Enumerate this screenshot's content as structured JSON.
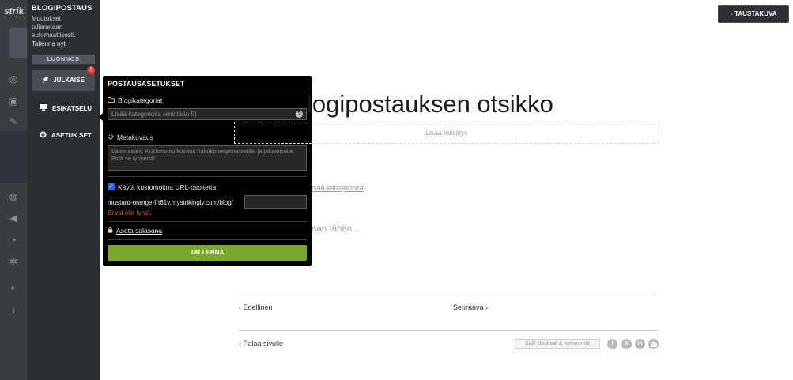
{
  "rail": {
    "logo": "strik"
  },
  "sidebar": {
    "title": "BLOGIPOSTAUS",
    "note": "Muutokset tallenetaan automaattisesti.",
    "save_now": "Tallenna nyt",
    "draft": "LUONNOS",
    "publish": "JULKAISE",
    "alert": "!",
    "preview": "ESIKATSELU",
    "settings": "ASETUK SET"
  },
  "popover": {
    "title": "POSTAUSASETUKSET",
    "category_label": "Blogikategoriat",
    "category_placeholder": "Lisää kategorioita (enintään 5)",
    "meta_label": "Metakuvaus",
    "meta_placeholder": "Valinnainen. Kustomoitu kuvaus hakukoneoptimoinnille ja jakamiselle. Pidä se lyhyenä!",
    "custom_url_label": "Käytä kustomoitua URL-osoitetta.",
    "url_prefix": "mustard-orange-frt61v.mystrikingly.com/blog/",
    "url_error": "Ei voi olla tyhjä.",
    "password_link": "Aseta salasana",
    "save_button": "TALLENNA"
  },
  "editor": {
    "background_button": "TAUSTAKUVA",
    "title_fragment": "logipostauksen otsikko",
    "subtitle_placeholder": "Lisää tekstitys",
    "add_category_fragment": "isää kategorioita",
    "body_fragment": "aan tähän...",
    "prev": "Edellinen",
    "next": "Seuraava",
    "back": "Palaa sivulle",
    "comments_button": "Salli tilaukset & kommentit"
  },
  "colors": {
    "accent_green": "#7aa829",
    "error_red": "#e05a4f",
    "alert_red": "#e2403a"
  },
  "icons": [
    "rocket-icon",
    "preview-icon",
    "gear-icon",
    "folder-icon",
    "tag-icon",
    "lock-icon",
    "facebook-icon",
    "x-icon",
    "linkedin-icon",
    "email-icon"
  ]
}
